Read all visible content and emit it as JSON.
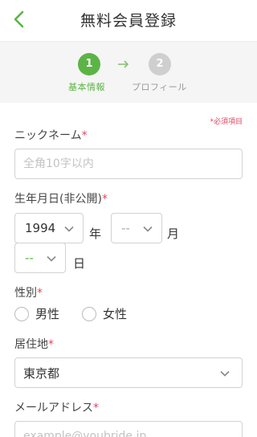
{
  "header": {
    "title": "無料会員登録",
    "back_icon": "chevron-left-icon",
    "accent_color": "#5cb446"
  },
  "steps": [
    {
      "number": "1",
      "label": "基本情報",
      "active": true
    },
    {
      "number": "2",
      "label": "プロフィール",
      "active": false
    }
  ],
  "required_note": "*必須項目",
  "form": {
    "nickname": {
      "label": "ニックネーム",
      "required_mark": "*",
      "placeholder": "全角10字以内",
      "value": ""
    },
    "birthday": {
      "label": "生年月日(非公開)",
      "required_mark": "*",
      "year": {
        "value": "1994",
        "unit": "年"
      },
      "month": {
        "value": "--",
        "unit": "月"
      },
      "day": {
        "value": "--",
        "unit": "日"
      }
    },
    "gender": {
      "label": "性別",
      "required_mark": "*",
      "options": [
        "男性",
        "女性"
      ]
    },
    "residence": {
      "label": "居住地",
      "required_mark": "*",
      "value": "東京都"
    },
    "email": {
      "label": "メールアドレス",
      "required_mark": "*",
      "placeholder": "example@youbride.jp",
      "value": ""
    }
  }
}
